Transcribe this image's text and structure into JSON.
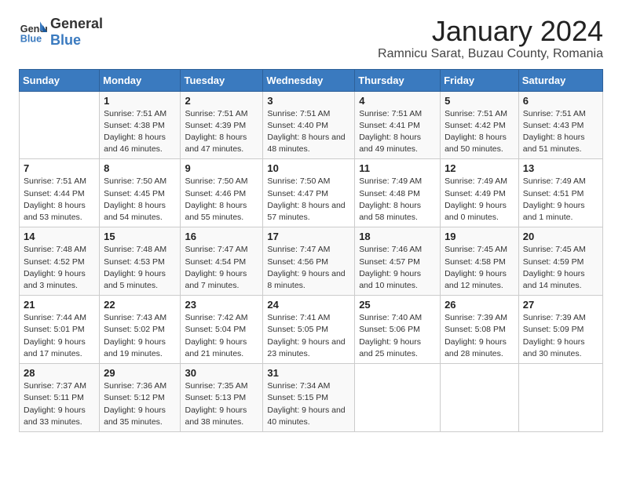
{
  "header": {
    "logo_general": "General",
    "logo_blue": "Blue",
    "title": "January 2024",
    "subtitle": "Ramnicu Sarat, Buzau County, Romania"
  },
  "days_of_week": [
    "Sunday",
    "Monday",
    "Tuesday",
    "Wednesday",
    "Thursday",
    "Friday",
    "Saturday"
  ],
  "weeks": [
    [
      {
        "day": "",
        "sunrise": "",
        "sunset": "",
        "daylight": ""
      },
      {
        "day": "1",
        "sunrise": "Sunrise: 7:51 AM",
        "sunset": "Sunset: 4:38 PM",
        "daylight": "Daylight: 8 hours and 46 minutes."
      },
      {
        "day": "2",
        "sunrise": "Sunrise: 7:51 AM",
        "sunset": "Sunset: 4:39 PM",
        "daylight": "Daylight: 8 hours and 47 minutes."
      },
      {
        "day": "3",
        "sunrise": "Sunrise: 7:51 AM",
        "sunset": "Sunset: 4:40 PM",
        "daylight": "Daylight: 8 hours and 48 minutes."
      },
      {
        "day": "4",
        "sunrise": "Sunrise: 7:51 AM",
        "sunset": "Sunset: 4:41 PM",
        "daylight": "Daylight: 8 hours and 49 minutes."
      },
      {
        "day": "5",
        "sunrise": "Sunrise: 7:51 AM",
        "sunset": "Sunset: 4:42 PM",
        "daylight": "Daylight: 8 hours and 50 minutes."
      },
      {
        "day": "6",
        "sunrise": "Sunrise: 7:51 AM",
        "sunset": "Sunset: 4:43 PM",
        "daylight": "Daylight: 8 hours and 51 minutes."
      }
    ],
    [
      {
        "day": "7",
        "sunrise": "Sunrise: 7:51 AM",
        "sunset": "Sunset: 4:44 PM",
        "daylight": "Daylight: 8 hours and 53 minutes."
      },
      {
        "day": "8",
        "sunrise": "Sunrise: 7:50 AM",
        "sunset": "Sunset: 4:45 PM",
        "daylight": "Daylight: 8 hours and 54 minutes."
      },
      {
        "day": "9",
        "sunrise": "Sunrise: 7:50 AM",
        "sunset": "Sunset: 4:46 PM",
        "daylight": "Daylight: 8 hours and 55 minutes."
      },
      {
        "day": "10",
        "sunrise": "Sunrise: 7:50 AM",
        "sunset": "Sunset: 4:47 PM",
        "daylight": "Daylight: 8 hours and 57 minutes."
      },
      {
        "day": "11",
        "sunrise": "Sunrise: 7:49 AM",
        "sunset": "Sunset: 4:48 PM",
        "daylight": "Daylight: 8 hours and 58 minutes."
      },
      {
        "day": "12",
        "sunrise": "Sunrise: 7:49 AM",
        "sunset": "Sunset: 4:49 PM",
        "daylight": "Daylight: 9 hours and 0 minutes."
      },
      {
        "day": "13",
        "sunrise": "Sunrise: 7:49 AM",
        "sunset": "Sunset: 4:51 PM",
        "daylight": "Daylight: 9 hours and 1 minute."
      }
    ],
    [
      {
        "day": "14",
        "sunrise": "Sunrise: 7:48 AM",
        "sunset": "Sunset: 4:52 PM",
        "daylight": "Daylight: 9 hours and 3 minutes."
      },
      {
        "day": "15",
        "sunrise": "Sunrise: 7:48 AM",
        "sunset": "Sunset: 4:53 PM",
        "daylight": "Daylight: 9 hours and 5 minutes."
      },
      {
        "day": "16",
        "sunrise": "Sunrise: 7:47 AM",
        "sunset": "Sunset: 4:54 PM",
        "daylight": "Daylight: 9 hours and 7 minutes."
      },
      {
        "day": "17",
        "sunrise": "Sunrise: 7:47 AM",
        "sunset": "Sunset: 4:56 PM",
        "daylight": "Daylight: 9 hours and 8 minutes."
      },
      {
        "day": "18",
        "sunrise": "Sunrise: 7:46 AM",
        "sunset": "Sunset: 4:57 PM",
        "daylight": "Daylight: 9 hours and 10 minutes."
      },
      {
        "day": "19",
        "sunrise": "Sunrise: 7:45 AM",
        "sunset": "Sunset: 4:58 PM",
        "daylight": "Daylight: 9 hours and 12 minutes."
      },
      {
        "day": "20",
        "sunrise": "Sunrise: 7:45 AM",
        "sunset": "Sunset: 4:59 PM",
        "daylight": "Daylight: 9 hours and 14 minutes."
      }
    ],
    [
      {
        "day": "21",
        "sunrise": "Sunrise: 7:44 AM",
        "sunset": "Sunset: 5:01 PM",
        "daylight": "Daylight: 9 hours and 17 minutes."
      },
      {
        "day": "22",
        "sunrise": "Sunrise: 7:43 AM",
        "sunset": "Sunset: 5:02 PM",
        "daylight": "Daylight: 9 hours and 19 minutes."
      },
      {
        "day": "23",
        "sunrise": "Sunrise: 7:42 AM",
        "sunset": "Sunset: 5:04 PM",
        "daylight": "Daylight: 9 hours and 21 minutes."
      },
      {
        "day": "24",
        "sunrise": "Sunrise: 7:41 AM",
        "sunset": "Sunset: 5:05 PM",
        "daylight": "Daylight: 9 hours and 23 minutes."
      },
      {
        "day": "25",
        "sunrise": "Sunrise: 7:40 AM",
        "sunset": "Sunset: 5:06 PM",
        "daylight": "Daylight: 9 hours and 25 minutes."
      },
      {
        "day": "26",
        "sunrise": "Sunrise: 7:39 AM",
        "sunset": "Sunset: 5:08 PM",
        "daylight": "Daylight: 9 hours and 28 minutes."
      },
      {
        "day": "27",
        "sunrise": "Sunrise: 7:39 AM",
        "sunset": "Sunset: 5:09 PM",
        "daylight": "Daylight: 9 hours and 30 minutes."
      }
    ],
    [
      {
        "day": "28",
        "sunrise": "Sunrise: 7:37 AM",
        "sunset": "Sunset: 5:11 PM",
        "daylight": "Daylight: 9 hours and 33 minutes."
      },
      {
        "day": "29",
        "sunrise": "Sunrise: 7:36 AM",
        "sunset": "Sunset: 5:12 PM",
        "daylight": "Daylight: 9 hours and 35 minutes."
      },
      {
        "day": "30",
        "sunrise": "Sunrise: 7:35 AM",
        "sunset": "Sunset: 5:13 PM",
        "daylight": "Daylight: 9 hours and 38 minutes."
      },
      {
        "day": "31",
        "sunrise": "Sunrise: 7:34 AM",
        "sunset": "Sunset: 5:15 PM",
        "daylight": "Daylight: 9 hours and 40 minutes."
      },
      {
        "day": "",
        "sunrise": "",
        "sunset": "",
        "daylight": ""
      },
      {
        "day": "",
        "sunrise": "",
        "sunset": "",
        "daylight": ""
      },
      {
        "day": "",
        "sunrise": "",
        "sunset": "",
        "daylight": ""
      }
    ]
  ]
}
